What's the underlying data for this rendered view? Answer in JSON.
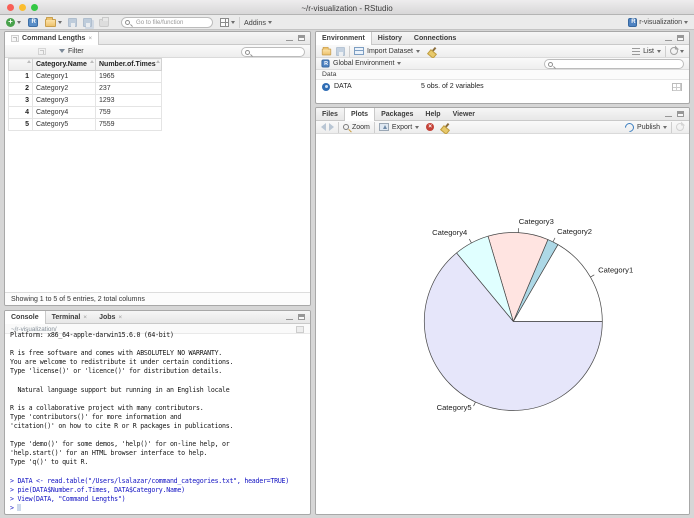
{
  "window": {
    "title": "~/r-visualization - RStudio"
  },
  "toolbar": {
    "goto_placeholder": "Go to file/function",
    "addins_label": "Addins",
    "project_label": "r-visualization"
  },
  "data_viewer": {
    "tab_title": "Command Lengths",
    "filter_label": "Filter",
    "table": {
      "columns": [
        "",
        "Category.Name",
        "Number.of.Times"
      ],
      "rows": [
        [
          "1",
          "Category1",
          "1965"
        ],
        [
          "2",
          "Category2",
          "237"
        ],
        [
          "3",
          "Category3",
          "1293"
        ],
        [
          "4",
          "Category4",
          "759"
        ],
        [
          "5",
          "Category5",
          "7559"
        ]
      ]
    },
    "footer": "Showing 1 to 5 of 5 entries, 2 total columns"
  },
  "console": {
    "tabs": [
      "Console",
      "Terminal",
      "Jobs"
    ],
    "path": "~/r-visualization/",
    "lines": [
      {
        "text": "Platform: x86_64-apple-darwin15.6.0 (64-bit)",
        "type": "output"
      },
      {
        "text": "",
        "type": "output"
      },
      {
        "text": "R is free software and comes with ABSOLUTELY NO WARRANTY.",
        "type": "output"
      },
      {
        "text": "You are welcome to redistribute it under certain conditions.",
        "type": "output"
      },
      {
        "text": "Type 'license()' or 'licence()' for distribution details.",
        "type": "output"
      },
      {
        "text": "",
        "type": "output"
      },
      {
        "text": "  Natural language support but running in an English locale",
        "type": "output"
      },
      {
        "text": "",
        "type": "output"
      },
      {
        "text": "R is a collaborative project with many contributors.",
        "type": "output"
      },
      {
        "text": "Type 'contributors()' for more information and",
        "type": "output"
      },
      {
        "text": "'citation()' on how to cite R or R packages in publications.",
        "type": "output"
      },
      {
        "text": "",
        "type": "output"
      },
      {
        "text": "Type 'demo()' for some demos, 'help()' for on-line help, or",
        "type": "output"
      },
      {
        "text": "'help.start()' for an HTML browser interface to help.",
        "type": "output"
      },
      {
        "text": "Type 'q()' to quit R.",
        "type": "output"
      },
      {
        "text": "",
        "type": "output"
      },
      {
        "text": "> DATA <- read.table(\"/Users/lsalazar/command_categories.txt\", header=TRUE)",
        "type": "input"
      },
      {
        "text": "> pie(DATA$Number.of.Times, DATA$Category.Name)",
        "type": "input"
      },
      {
        "text": "> View(DATA, \"Command Lengths\")",
        "type": "input"
      },
      {
        "text": "> ",
        "type": "input",
        "cursor": true
      }
    ]
  },
  "environment": {
    "tabs": [
      "Environment",
      "History",
      "Connections"
    ],
    "import_label": "Import Dataset",
    "list_label": "List",
    "scope_label": "Global Environment",
    "section_header": "Data",
    "objects": [
      {
        "name": "DATA",
        "value": "5 obs. of 2 variables"
      }
    ]
  },
  "plots": {
    "tabs": [
      "Files",
      "Plots",
      "Packages",
      "Help",
      "Viewer"
    ],
    "zoom_label": "Zoom",
    "export_label": "Export",
    "publish_label": "Publish"
  },
  "chart_data": {
    "type": "pie",
    "labels": [
      "Category1",
      "Category2",
      "Category3",
      "Category4",
      "Category5"
    ],
    "values": [
      1965,
      237,
      1293,
      759,
      7559
    ],
    "colors": [
      "#FFFFFF",
      "#ADD8E6",
      "#FFE4E1",
      "#E0FFFF",
      "#E6E6FA"
    ],
    "start_angle_deg": 0,
    "direction": "counterclockwise",
    "border_color": "#454545",
    "label_color": "#1d1d1d"
  }
}
